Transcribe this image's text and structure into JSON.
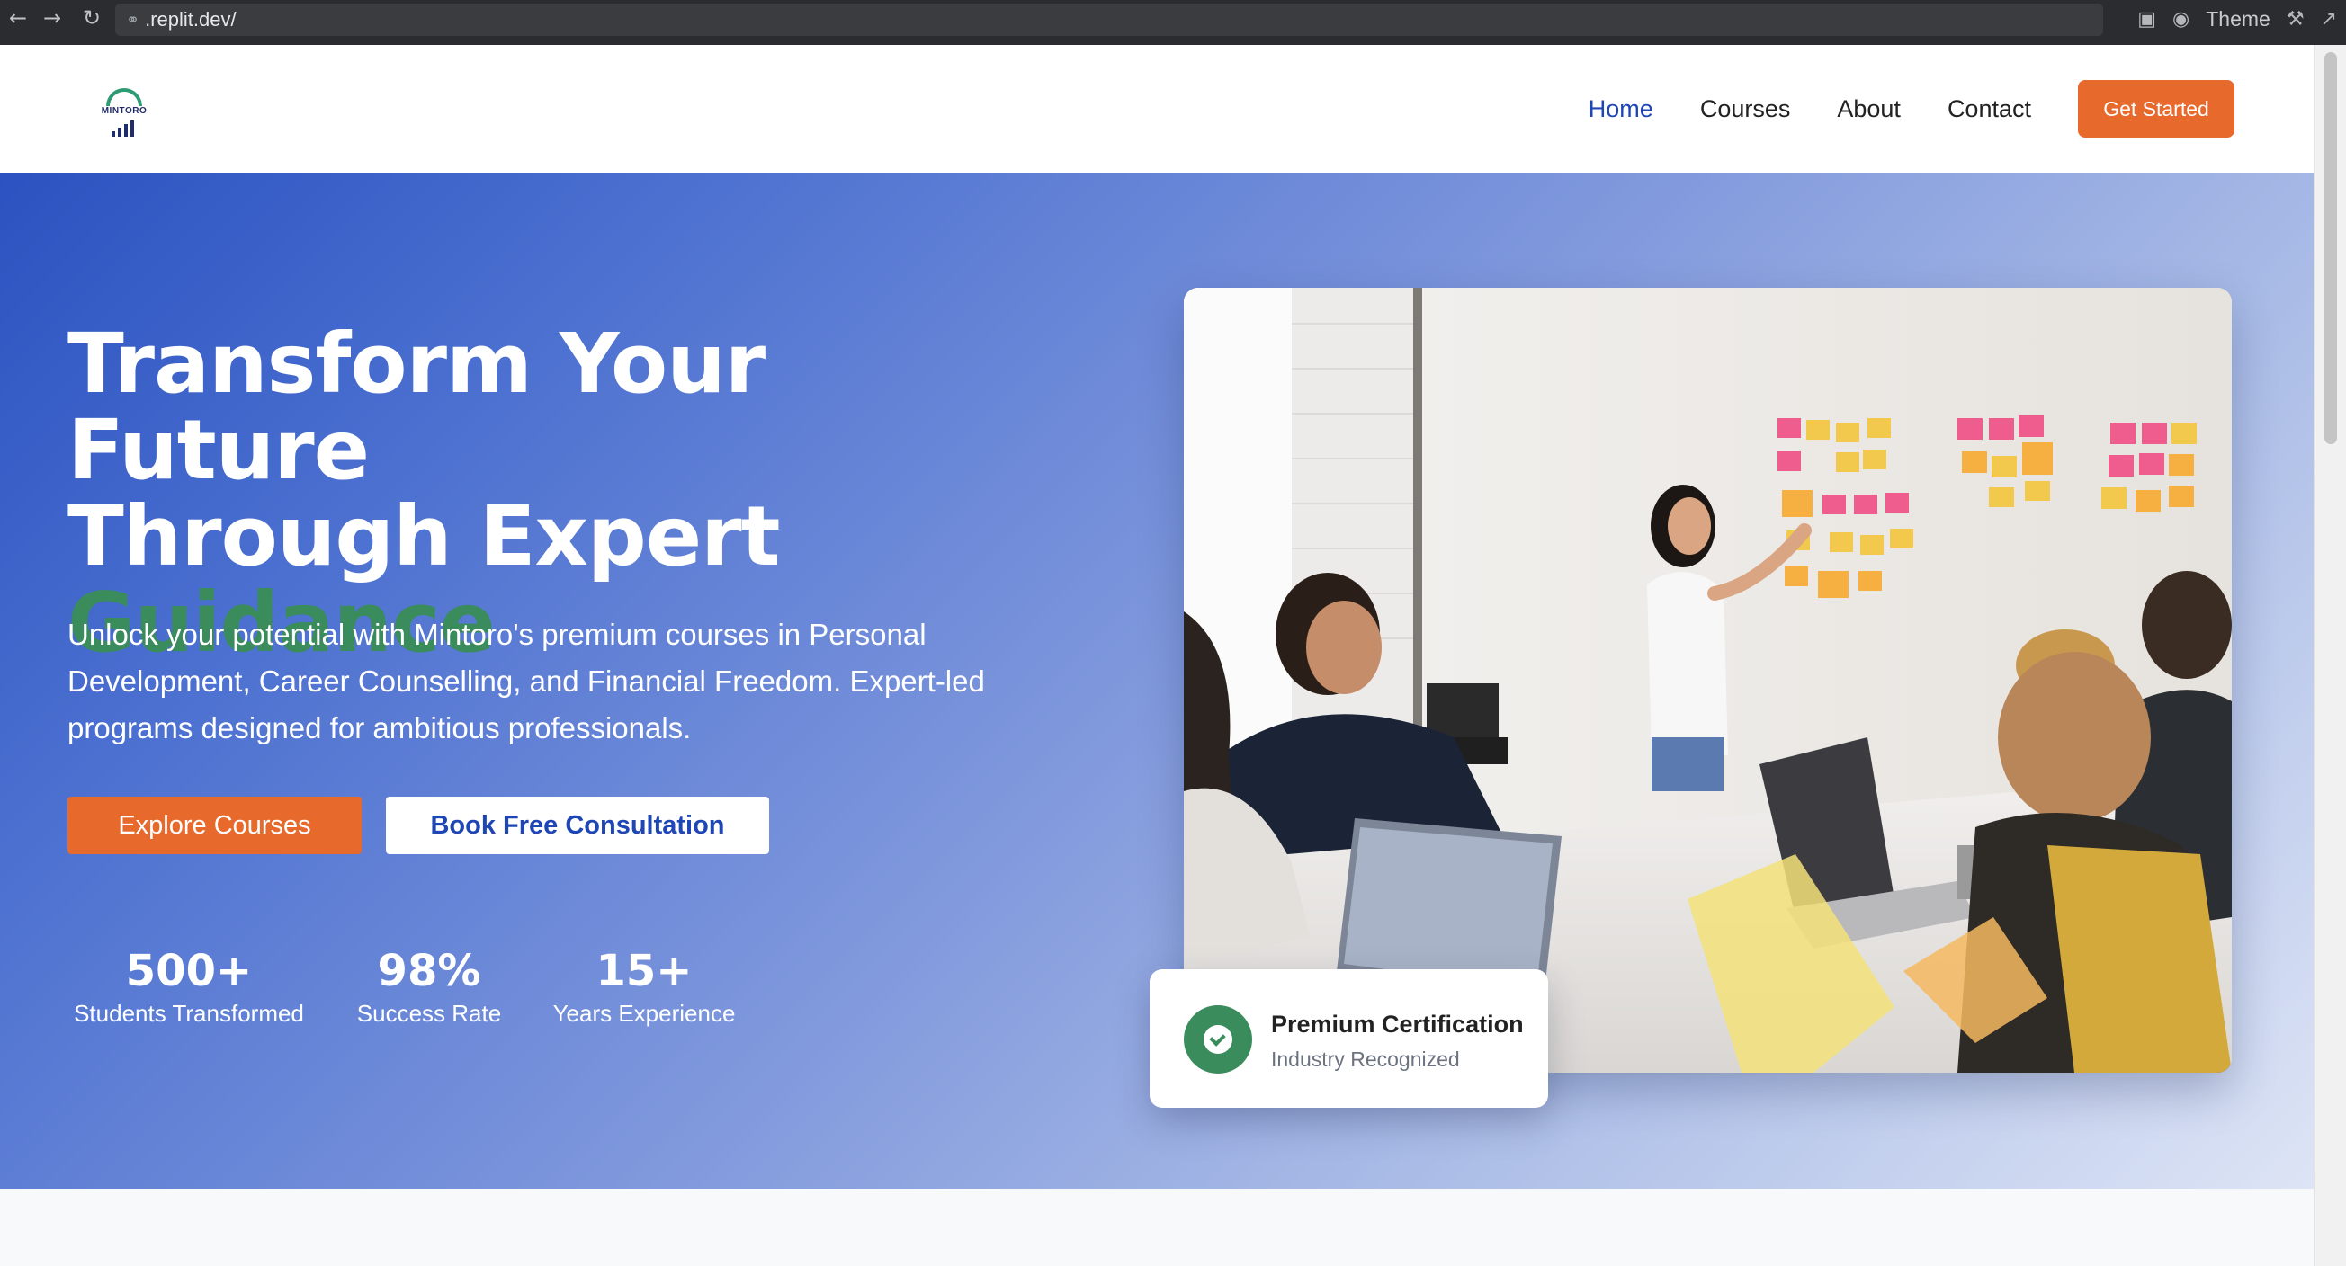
{
  "browser": {
    "url": ".replit.dev/",
    "theme_label": "Theme"
  },
  "header": {
    "logo_text": "MINTORO",
    "nav": [
      {
        "label": "Home"
      },
      {
        "label": "Courses"
      },
      {
        "label": "About"
      },
      {
        "label": "Contact"
      }
    ],
    "cta_label": "Get Started"
  },
  "hero": {
    "title_line1": "Transform Your Future",
    "title_line2": "Through Expert",
    "title_accent": "Guidance",
    "description": "Unlock your potential with Mintoro's premium courses in Personal Development, Career Counselling, and Financial Freedom. Expert-led programs designed for ambitious professionals.",
    "primary_button": "Explore Courses",
    "secondary_button": "Book Free Consultation",
    "stats": [
      {
        "value": "500+",
        "label": "Students Transformed"
      },
      {
        "value": "98%",
        "label": "Success Rate"
      },
      {
        "value": "15+",
        "label": "Years Experience"
      }
    ]
  },
  "certification": {
    "title": "Premium Certification",
    "subtitle": "Industry Recognized"
  },
  "colors": {
    "brand_blue": "#1f46b5",
    "accent_orange": "#e8692c",
    "accent_green": "#3a8c5c"
  }
}
